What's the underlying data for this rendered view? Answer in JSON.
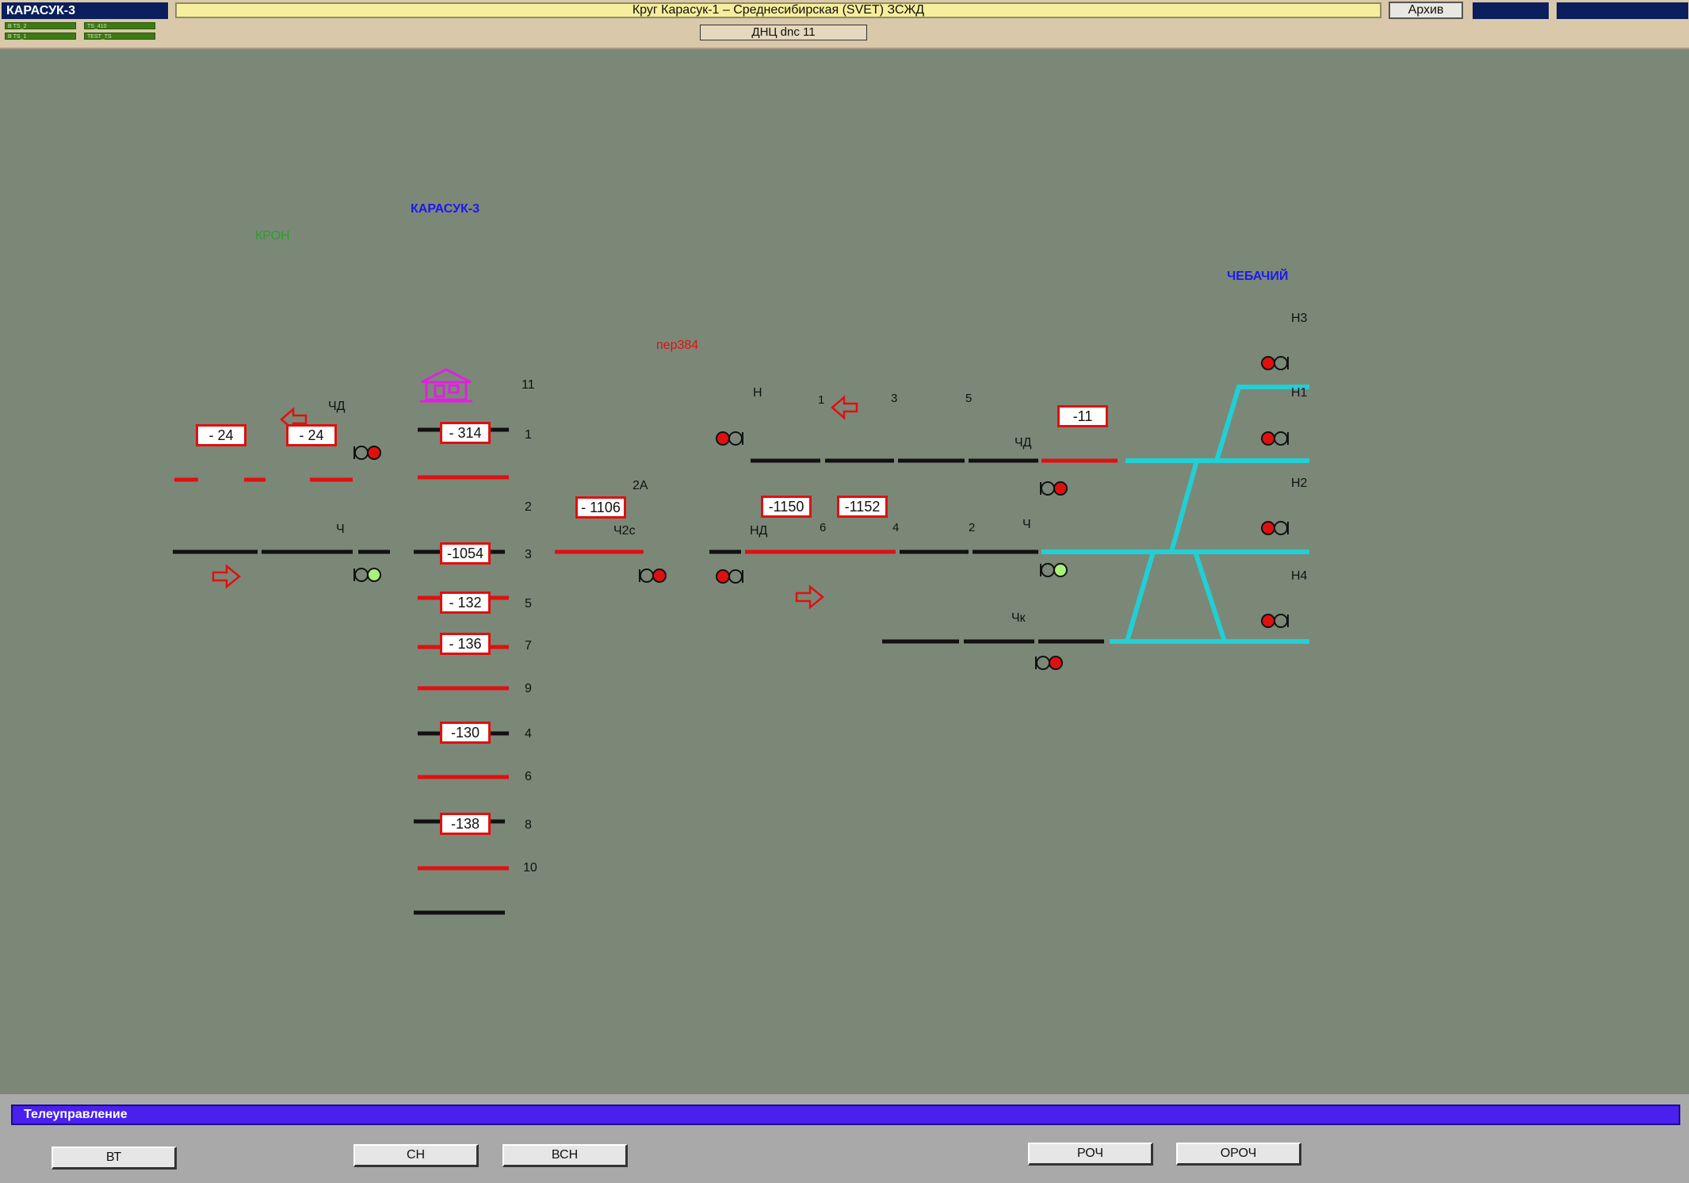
{
  "header": {
    "station": "КАРАСУК-3",
    "indicators": [
      "В TS_2",
      "TS_410",
      "В TS_1",
      "TEST_TS"
    ],
    "route_title": "Круг Карасук-1 – Среднесибирская (SVET) ЗСЖД",
    "archive_label": "Архив",
    "dnc_label": "ДНЦ dnc 11"
  },
  "colors": {
    "track": "#111111",
    "occupied": "#e01010",
    "route": "#22cfd4",
    "background": "#7b8878",
    "station_left": "#1a1aee",
    "station_right": "#1a1aee",
    "kron": "#2aa02a",
    "per": "#e01010",
    "building": "#e020e0"
  },
  "diagram": {
    "station_left_label": "КАРАСУК-3",
    "station_right_label": "ЧЕБАЧИЙ",
    "kron_label": "КРОН",
    "per_label": "пер384",
    "building_icon": "station-building-icon",
    "track_numbers": [
      "11",
      "1",
      "2",
      "3",
      "5",
      "7",
      "9",
      "4",
      "6",
      "8",
      "10"
    ],
    "trains": {
      "t24a": "- 24",
      "t24b": "- 24",
      "t314": "- 314",
      "t1054": "-1054",
      "t132": "- 132",
      "t136": "- 136",
      "t130": "-130",
      "t138": "-138",
      "t1106": "- 1106",
      "t1150": "-1150",
      "t1152": "-1152",
      "t11": "-11"
    },
    "signals": {
      "chd_left": "ЧД",
      "ch_left": "Ч",
      "ch2s": "Ч2с",
      "n": "Н",
      "nd": "НД",
      "chd_right": "ЧД",
      "ch_right": "Ч",
      "chk": "Чк",
      "n3": "Н3",
      "n1": "Н1",
      "n2": "Н2",
      "n4": "Н4"
    },
    "section_labels": {
      "s2a": "2А",
      "s1": "1",
      "s3": "3",
      "s5": "5",
      "s6": "6",
      "s4": "4",
      "s2": "2"
    }
  },
  "footer": {
    "control_bar_label": "Телеуправление",
    "buttons": [
      "ВТ",
      "СН",
      "ВСН",
      "РОЧ",
      "ОРОЧ"
    ]
  }
}
